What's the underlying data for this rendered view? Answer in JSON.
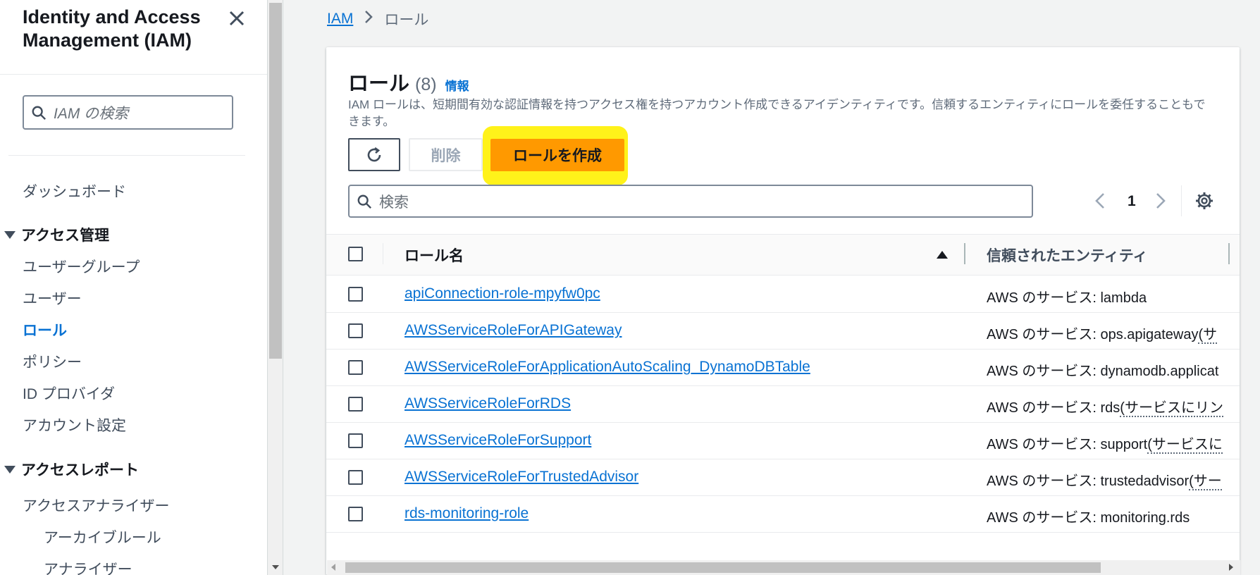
{
  "sidebar": {
    "title": "Identity and Access Management (IAM)",
    "search_placeholder": "IAM の検索",
    "dashboard": "ダッシュボード",
    "access_management": {
      "label": "アクセス管理",
      "items": [
        "ユーザーグループ",
        "ユーザー",
        "ロール",
        "ポリシー",
        "ID プロバイダ",
        "アカウント設定"
      ]
    },
    "access_reports": {
      "label": "アクセスレポート",
      "items": [
        "アクセスアナライザー"
      ],
      "sub_items": [
        "アーカイブルール",
        "アナライザー"
      ]
    }
  },
  "breadcrumb": {
    "root": "IAM",
    "current": "ロール"
  },
  "roles": {
    "title": "ロール",
    "count": "(8)",
    "info": "情報",
    "description": "IAM ロールは、短期間有効な認証情報を持つアクセス権を持つアカウント作成できるアイデンティティです。信頼するエンティティにロールを委任することもできます。",
    "delete_label": "削除",
    "create_label": "ロールを作成",
    "search_placeholder": "検索",
    "page": "1",
    "columns": {
      "name": "ロール名",
      "entity": "信頼されたエンティティ"
    },
    "rows": [
      {
        "name": "apiConnection-role-mpyfw0pc",
        "entity_prefix": "AWS のサービス: lambda",
        "entity_suffix": ""
      },
      {
        "name": "AWSServiceRoleForAPIGateway",
        "entity_prefix": "AWS のサービス: ops.apigateway",
        "entity_suffix": "(サ"
      },
      {
        "name": "AWSServiceRoleForApplicationAutoScaling_DynamoDBTable",
        "entity_prefix": "AWS のサービス: dynamodb.applicat",
        "entity_suffix": ""
      },
      {
        "name": "AWSServiceRoleForRDS",
        "entity_prefix": "AWS のサービス: rds",
        "entity_suffix": "(サービスにリン"
      },
      {
        "name": "AWSServiceRoleForSupport",
        "entity_prefix": "AWS のサービス: support",
        "entity_suffix": "(サービスに"
      },
      {
        "name": "AWSServiceRoleForTrustedAdvisor",
        "entity_prefix": "AWS のサービス: trustedadvisor",
        "entity_suffix": "(サー"
      },
      {
        "name": "rds-monitoring-role",
        "entity_prefix": "AWS のサービス: monitoring.rds",
        "entity_suffix": ""
      }
    ]
  },
  "colors": {
    "accent": "#0972d3",
    "primary_button": "#ff9900",
    "highlight": "#fff21a"
  }
}
